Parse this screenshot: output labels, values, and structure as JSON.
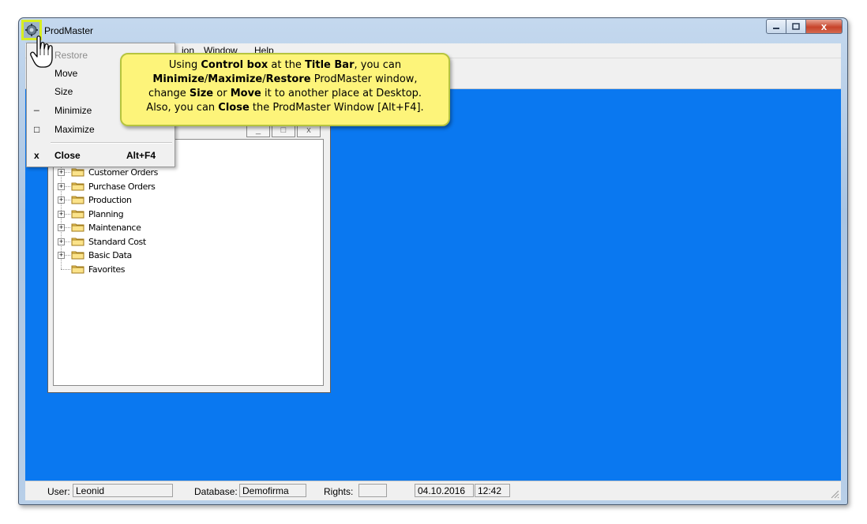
{
  "window": {
    "title": "ProdMaster",
    "close_glyph": "x",
    "minimize_icon": "minimize-icon",
    "maximize_icon": "maximize-icon"
  },
  "menubar": {
    "items": [
      "Action",
      "Window",
      "Help"
    ],
    "visible_partial": [
      "ion",
      "Window",
      "Help"
    ]
  },
  "system_menu": {
    "items": [
      {
        "label": "Restore",
        "icon": "",
        "shortcut": "",
        "enabled": false,
        "bold": false
      },
      {
        "label": "Move",
        "icon": "",
        "shortcut": "",
        "enabled": true,
        "bold": false
      },
      {
        "label": "Size",
        "icon": "",
        "shortcut": "",
        "enabled": true,
        "bold": false
      },
      {
        "label": "Minimize",
        "icon": "_",
        "shortcut": "",
        "enabled": true,
        "bold": false
      },
      {
        "label": "Maximize",
        "icon": "□",
        "shortcut": "",
        "enabled": true,
        "bold": false
      },
      {
        "label": "Close",
        "icon": "x",
        "shortcut": "Alt+F4",
        "enabled": true,
        "bold": true
      }
    ]
  },
  "callout": {
    "line1_pre": "Using ",
    "line1_b1": "Control box",
    "line1_mid": " at the ",
    "line1_b2": "Title Bar",
    "line1_post": ", you can",
    "line2_b1": "Minimize",
    "line2_s1": "/",
    "line2_b2": "Maximize",
    "line2_s2": "/",
    "line2_b3": "Restore",
    "line2_post": " ProdMaster window,",
    "line3_pre": "change ",
    "line3_b1": "Size",
    "line3_mid": " or ",
    "line3_b2": "Move",
    "line3_post": " it to another place at Desktop.",
    "line4_pre": "Also, you can ",
    "line4_b1": "Close",
    "line4_post": " the ProdMaster Window [Alt+F4]."
  },
  "tree": {
    "items": [
      {
        "label": "Customer Orders",
        "expandable": true
      },
      {
        "label": "Purchase Orders",
        "expandable": true
      },
      {
        "label": "Production",
        "expandable": true
      },
      {
        "label": "Planning",
        "expandable": true
      },
      {
        "label": "Maintenance",
        "expandable": true
      },
      {
        "label": "Standard Cost",
        "expandable": true
      },
      {
        "label": "Basic Data",
        "expandable": true
      },
      {
        "label": "Favorites",
        "expandable": false
      }
    ]
  },
  "statusbar": {
    "user_label": "User:",
    "user_value": "Leonid",
    "database_label": "Database:",
    "database_value": "Demofirma",
    "rights_label": "Rights:",
    "rights_value": "",
    "date": "04.10.2016",
    "time": "12:42"
  },
  "colors": {
    "mdi_background": "#0a78f0",
    "callout_background": "#fdf47a",
    "highlight": "#d8ee20"
  }
}
